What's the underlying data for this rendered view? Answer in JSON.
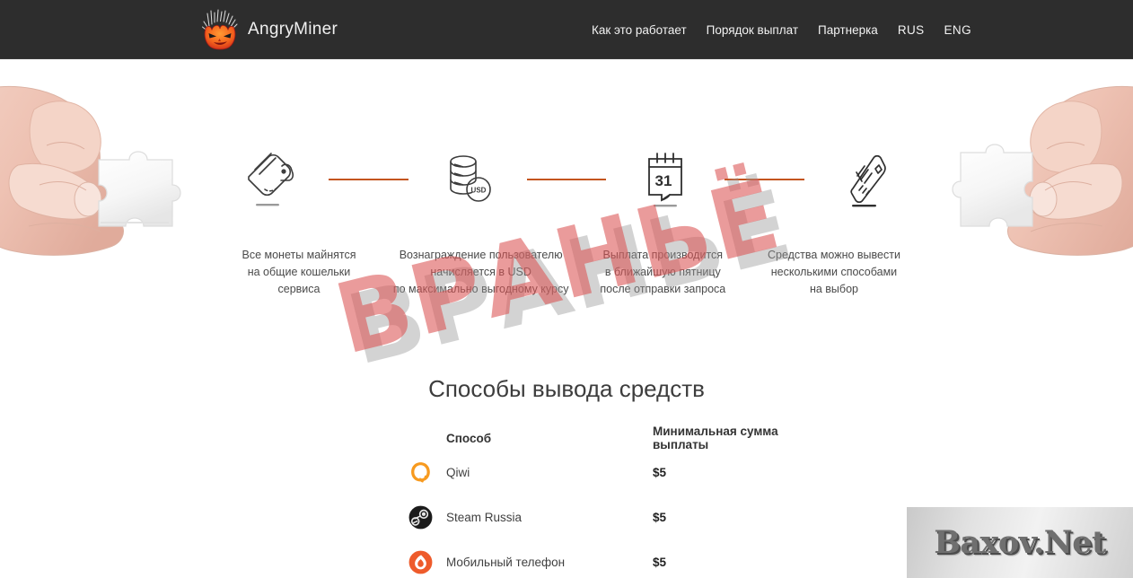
{
  "header": {
    "brand": {
      "name": "AngryMiner",
      "logo_icon": "angry-devil-miner-logo"
    },
    "nav": [
      {
        "label": "Как это работает",
        "name": "nav-how-it-works"
      },
      {
        "label": "Порядок выплат",
        "name": "nav-payout-order"
      },
      {
        "label": "Партнерка",
        "name": "nav-affiliate"
      },
      {
        "label": "RUS",
        "name": "nav-lang-rus"
      },
      {
        "label": "ENG",
        "name": "nav-lang-eng"
      }
    ],
    "colors": {
      "background": "#2d2d2d",
      "text": "#f2f2f2"
    }
  },
  "hero": {
    "left_image_alt": "hand-holding-puzzle-piece",
    "right_image_alt": "hand-holding-puzzle-piece-mirrored"
  },
  "steps": {
    "connector_color": "#c4551f",
    "items": [
      {
        "icon": "wallet-icon",
        "lines": [
          "Все монеты майнятся",
          "на общие кошельки",
          "сервиса"
        ]
      },
      {
        "icon": "usd-coins-stack-icon",
        "lines": [
          "Вознаграждение пользователю",
          "начисляется в USD",
          "по максимально выгодному курсу"
        ]
      },
      {
        "icon": "calendar-31-icon",
        "lines": [
          "Выплата производится",
          "в ближайшую пятницу",
          "после отправки запроса"
        ]
      },
      {
        "icon": "credit-card-icon",
        "lines": [
          "Средства можно вывести",
          "несколькими способами",
          "на выбор"
        ]
      }
    ]
  },
  "withdraw": {
    "title": "Способы вывода средств",
    "columns": [
      "Способ",
      "Минимальная сумма выплаты"
    ],
    "rows": [
      {
        "icon": "qiwi-icon",
        "method": "Qiwi",
        "amount": "$5"
      },
      {
        "icon": "steam-icon",
        "method": "Steam Russia",
        "amount": "$5"
      },
      {
        "icon": "mobile-phone-icon",
        "method": "Мобильный телефон",
        "amount": "$5"
      }
    ]
  },
  "watermarks": {
    "main": "ВРАНЬЁ",
    "brand": "Baxov.Net"
  }
}
